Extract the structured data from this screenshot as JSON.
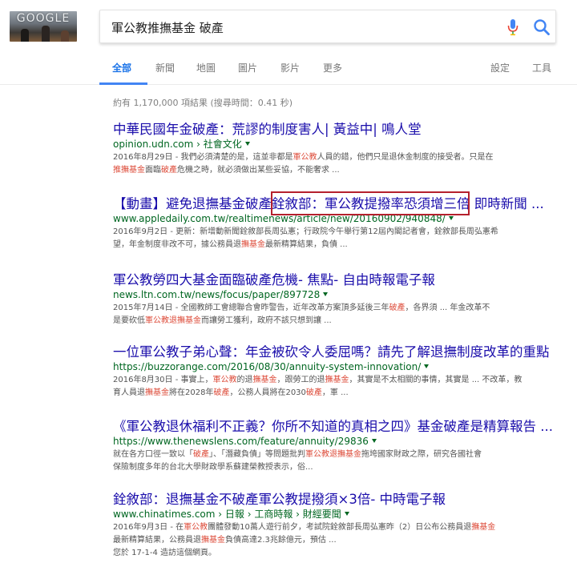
{
  "logo": {
    "text": "GOOGLE"
  },
  "search": {
    "query": "軍公教推撫基金 破產"
  },
  "tabs": [
    {
      "label": "全部",
      "active": true
    },
    {
      "label": "新聞"
    },
    {
      "label": "地圖"
    },
    {
      "label": "圖片"
    },
    {
      "label": "影片"
    },
    {
      "label": "更多"
    }
  ],
  "tools": {
    "settings": "設定",
    "tools": "工具"
  },
  "stats": "約有 1,170,000 項結果 (搜尋時間：0.41 秒)",
  "results": [
    {
      "title": "中華民國年金破產：荒謬的制度害人| 黃益中| 鳴人堂",
      "url": "opinion.udn.com › 社會文化",
      "snippet1": [
        {
          "t": "2016年8月29日 - 我們必須清楚的是，這並非都是"
        },
        {
          "t": "軍公教",
          "h": true
        },
        {
          "t": "人員的錯，他們只是退休金制度的接受者。只是在"
        }
      ],
      "snippet2": [
        {
          "t": "推撫基金",
          "h": true
        },
        {
          "t": "面臨"
        },
        {
          "t": "破產",
          "h": true
        },
        {
          "t": "危機之時，就必須做出某些妥協，不能奢求 ..."
        }
      ]
    },
    {
      "title": "【動畫】避免退撫基金破產銓敘部：軍公教提撥率恐須增三倍 即時新聞 ...",
      "url": "www.appledaily.com.tw/realtimenews/article/new/20160902/940848/",
      "snippet1": [
        {
          "t": "2016年9月2日 - 更新：新增動新聞銓敘部長周弘憲；行政院今午舉行第12屆內閣記者會，銓敘部長周弘憲希"
        }
      ],
      "snippet2": [
        {
          "t": "望，年金制度非改不可，據公務員退"
        },
        {
          "t": "撫基金",
          "h": true
        },
        {
          "t": "最新精算結果，負債 ..."
        }
      ]
    },
    {
      "title": "軍公教勞四大基金面臨破產危機- 焦點- 自由時報電子報",
      "url": "news.ltn.com.tw/news/focus/paper/897728",
      "snippet1": [
        {
          "t": "2015年7月14日 - 全國教師工會總聯合會昨警告，近年改革方案頂多延後三年"
        },
        {
          "t": "破產",
          "h": true
        },
        {
          "t": "，各界須 ... 年金改革不"
        }
      ],
      "snippet2": [
        {
          "t": "是要砍低"
        },
        {
          "t": "軍公教退撫基金",
          "h": true
        },
        {
          "t": "而讓勞工獲利，政府不該只想到讓 ..."
        }
      ]
    },
    {
      "title": "一位軍公教子弟心聲：年金被砍令人委屈嗎？請先了解退撫制度改革的重點",
      "url": "https://buzzorange.com/2016/08/30/annuity-system-innovation/",
      "snippet1": [
        {
          "t": "2016年8月30日 - 事實上，"
        },
        {
          "t": "軍公教",
          "h": true
        },
        {
          "t": "的退"
        },
        {
          "t": "撫基金",
          "h": true
        },
        {
          "t": "，跟勞工的退"
        },
        {
          "t": "撫基金",
          "h": true
        },
        {
          "t": "，其實是不太相關的事情，其實是 ... 不改革，教"
        }
      ],
      "snippet2": [
        {
          "t": "育人員退"
        },
        {
          "t": "撫基金",
          "h": true
        },
        {
          "t": "將在2028年"
        },
        {
          "t": "破產",
          "h": true
        },
        {
          "t": "，公務人員將在2030"
        },
        {
          "t": "破產",
          "h": true
        },
        {
          "t": "，軍 ..."
        }
      ]
    },
    {
      "title": "《軍公教退休福利不正義？你所不知道的真相之四》基金破產是精算報告 ...",
      "url": "https://www.thenewslens.com/feature/annuity/29836",
      "snippet1": [
        {
          "t": "就在各方口徑一致以「"
        },
        {
          "t": "破產",
          "h": true
        },
        {
          "t": "」、「潛藏負債」等問題批判"
        },
        {
          "t": "軍公教退撫基金",
          "h": true
        },
        {
          "t": "拖垮國家財政之際，研究各國社會"
        }
      ],
      "snippet2": [
        {
          "t": "保險制度多年的台北大學財政學系蘇建榮教授表示，俗..."
        }
      ]
    },
    {
      "title": "銓敘部：退撫基金不破產軍公教提撥須×3倍- 中時電子報",
      "url": "www.chinatimes.com › 日報 › 工商時報 › 財經要聞",
      "snippet1": [
        {
          "t": "2016年9月3日 - 在"
        },
        {
          "t": "軍公教",
          "h": true
        },
        {
          "t": "團體發動10萬人遊行前夕，考試院銓敘部長周弘憲昨（2）日公布公務員退"
        },
        {
          "t": "撫基金",
          "h": true
        }
      ],
      "snippet2": [
        {
          "t": "最新精算結果，公務員退"
        },
        {
          "t": "撫基金",
          "h": true
        },
        {
          "t": "負債高達2.3兆餘億元，預估 ..."
        }
      ],
      "visited": "您於 17-1-4 造訪這個網頁。"
    }
  ],
  "colors": {
    "link": "#1a0dab",
    "url": "#006621",
    "snippet": "#545454",
    "highlight": "#dd4b39",
    "tab_active": "#1a73e8",
    "annotation_box": "#b5202d"
  }
}
